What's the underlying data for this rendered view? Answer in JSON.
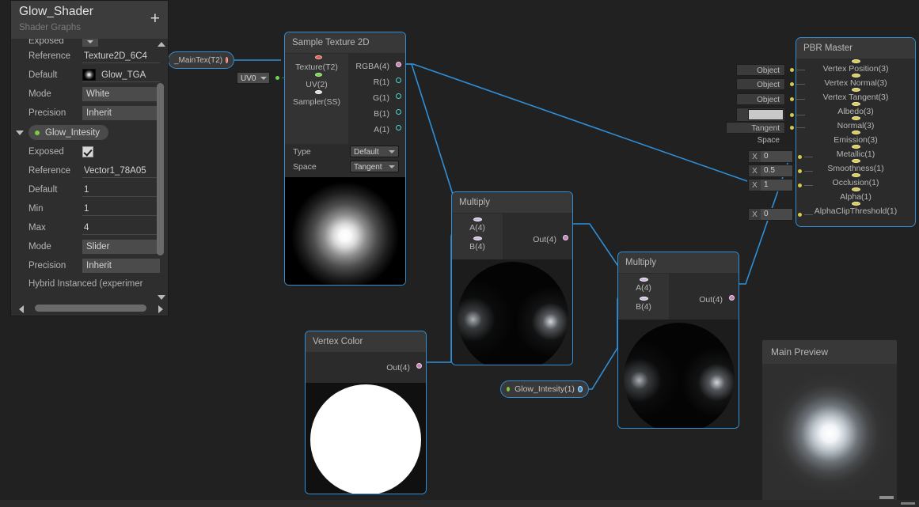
{
  "blackboard": {
    "title": "Glow_Shader",
    "subtitle": "Shader Graphs",
    "add_label": "+",
    "texture_property": {
      "exposed_label": "Exposed",
      "reference_label": "Reference",
      "reference_value": "Texture2D_6C4",
      "default_label": "Default",
      "default_value": "Glow_TGA",
      "mode_label": "Mode",
      "mode_value": "White",
      "precision_label": "Precision",
      "precision_value": "Inherit"
    },
    "vector_property": {
      "name": "Glow_Intesity",
      "exposed_label": "Exposed",
      "reference_label": "Reference",
      "reference_value": "Vector1_78A05",
      "default_label": "Default",
      "default_value": "1",
      "min_label": "Min",
      "min_value": "1",
      "max_label": "Max",
      "max_value": "4",
      "mode_label": "Mode",
      "mode_value": "Slider",
      "precision_label": "Precision",
      "precision_value": "Inherit"
    },
    "hybrid_label": "Hybrid Instanced (experimer"
  },
  "nodes": {
    "main_tex": {
      "label": "_MainTex(T2)",
      "dot_color": "#e45b4d"
    },
    "uv0": {
      "label": "UV0"
    },
    "sample_texture": {
      "title": "Sample Texture 2D",
      "inputs": [
        "Texture(T2)",
        "UV(2)",
        "Sampler(SS)"
      ],
      "outputs": [
        "RGBA(4)",
        "R(1)",
        "G(1)",
        "B(1)",
        "A(1)"
      ],
      "settings": [
        {
          "label": "Type",
          "value": "Default"
        },
        {
          "label": "Space",
          "value": "Tangent"
        }
      ]
    },
    "multiply_1": {
      "title": "Multiply",
      "inputs": [
        "A(4)",
        "B(4)"
      ],
      "outputs": [
        "Out(4)"
      ]
    },
    "multiply_2": {
      "title": "Multiply",
      "inputs": [
        "A(4)",
        "B(4)"
      ],
      "outputs": [
        "Out(4)"
      ]
    },
    "vertex_color": {
      "title": "Vertex Color",
      "outputs": [
        "Out(4)"
      ]
    },
    "glow_intensity_pill": {
      "label": "Glow_Intesity(1)",
      "bullet_color": "#7ecb3f"
    },
    "pbr_master": {
      "title": "PBR Master",
      "slots": [
        "Vertex Position(3)",
        "Vertex Normal(3)",
        "Vertex Tangent(3)",
        "Albedo(3)",
        "Normal(3)",
        "Emission(3)",
        "Metallic(1)",
        "Smoothness(1)",
        "Occlusion(1)",
        "Alpha(1)",
        "AlphaClipThreshold(1)"
      ],
      "controls": [
        {
          "type": "chip",
          "value": "Object Space"
        },
        {
          "type": "chip",
          "value": "Object Space"
        },
        {
          "type": "chip",
          "value": "Object Space"
        },
        {
          "type": "swatch",
          "value": ""
        },
        {
          "type": "chip",
          "value": "Tangent Space"
        },
        {
          "type": "xfield",
          "axis": "X",
          "value": "0"
        },
        {
          "type": "xfield",
          "axis": "X",
          "value": "0.5"
        },
        {
          "type": "xfield",
          "axis": "X",
          "value": "1"
        },
        {
          "type": "xfield",
          "axis": "X",
          "value": "0"
        }
      ]
    }
  },
  "main_preview": {
    "title": "Main Preview"
  },
  "colors": {
    "accent": "#2f8fd8",
    "edge": "#2f8fd8",
    "node_bg": "#2b2b2b",
    "node_header": "#383838",
    "canvas": "#212121",
    "vec4_port": "#d6a4cf",
    "float_port": "#4ad8d0",
    "master_port": "#d9cc55"
  }
}
